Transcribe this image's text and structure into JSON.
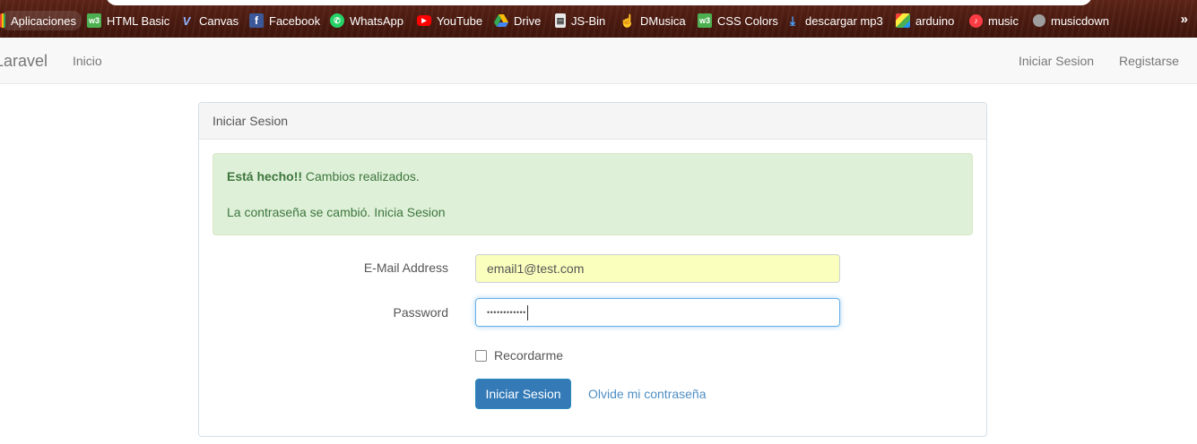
{
  "bookmarks": {
    "items": [
      {
        "label": "Aplicaciones",
        "icon": "apps-grid-icon"
      },
      {
        "label": "HTML Basic",
        "icon": "w3-icon"
      },
      {
        "label": "Canvas",
        "icon": "canvas-icon"
      },
      {
        "label": "Facebook",
        "icon": "facebook-icon"
      },
      {
        "label": "WhatsApp",
        "icon": "whatsapp-icon"
      },
      {
        "label": "YouTube",
        "icon": "youtube-icon"
      },
      {
        "label": "Drive",
        "icon": "drive-icon"
      },
      {
        "label": "JS-Bin",
        "icon": "jsbin-icon"
      },
      {
        "label": "DMusica",
        "icon": "hand-cursor-icon"
      },
      {
        "label": "CSS Colors",
        "icon": "w3-icon"
      },
      {
        "label": "descargar mp3",
        "icon": "download-icon"
      },
      {
        "label": "arduino",
        "icon": "arduino-icon"
      },
      {
        "label": "music",
        "icon": "music-icon"
      },
      {
        "label": "musicdown",
        "icon": "musicdown-icon"
      }
    ],
    "more": "»"
  },
  "navbar": {
    "brand": "Laravel",
    "home": "Inicio",
    "login": "Iniciar Sesion",
    "register": "Registarse"
  },
  "panel": {
    "heading": "Iniciar Sesion",
    "alert": {
      "strong": "Está hecho!!",
      "message": " Cambios realizados.",
      "detail": "La contraseña se cambió. Inicia Sesion"
    },
    "email_label": "E-Mail Address",
    "email_value": "email1@test.com",
    "password_label": "Password",
    "password_value": "••••••••••••",
    "remember_label": "Recordarme",
    "submit_label": "Iniciar Sesion",
    "forgot_label": "Olvide mi contraseña"
  },
  "colors": {
    "primary": "#337ab7",
    "success_bg": "#dff0d8",
    "success_text": "#3c763d",
    "autofill_bg": "#faffbd"
  }
}
